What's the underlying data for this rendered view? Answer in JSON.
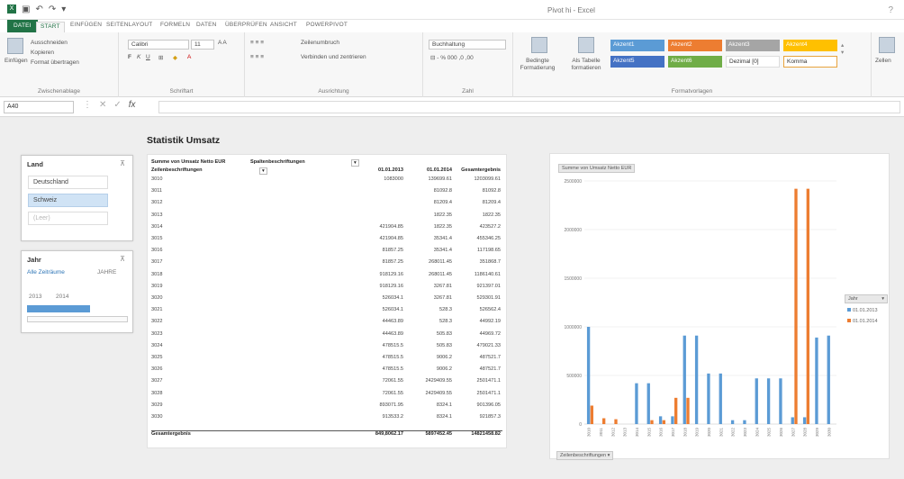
{
  "window": {
    "title": "Pivot hi - Excel"
  },
  "tabs": [
    "DATEI",
    "START",
    "EINFÜGEN",
    "SEITENLAYOUT",
    "FORMELN",
    "DATEN",
    "ÜBERPRÜFEN",
    "ANSICHT",
    "POWERPIVOT"
  ],
  "ribbon": {
    "clipboard": {
      "paste": "Einfügen",
      "cut": "Ausschneiden",
      "copy": "Kopieren",
      "format_painter": "Format übertragen",
      "label": "Zwischenablage"
    },
    "font": {
      "name": "Calibri",
      "size": "11",
      "label": "Schriftart"
    },
    "alignment": {
      "wrap": "Zeilenumbruch",
      "merge": "Verbinden und zentrieren",
      "label": "Ausrichtung"
    },
    "number": {
      "format": "Buchhaltung",
      "label": "Zahl"
    },
    "styles": {
      "conditional": "Bedingte Formatierung",
      "table": "Als Tabelle formatieren",
      "label": "Formatvorlagen",
      "cells": [
        {
          "text": "Akzent1",
          "color": "#5b9bd5"
        },
        {
          "text": "Akzent2",
          "color": "#ed7d31"
        },
        {
          "text": "Akzent3",
          "color": "#a5a5a5"
        },
        {
          "text": "Akzent4",
          "color": "#ffc000"
        },
        {
          "text": "Akzent5",
          "color": "#4472c4"
        },
        {
          "text": "Akzent6",
          "color": "#70ad47"
        },
        {
          "text": "Dezimal [0]",
          "color": "#ffffff"
        },
        {
          "text": "Komma",
          "color": "#ffffff"
        }
      ]
    },
    "cells_group": {
      "insert": "Zellen"
    }
  },
  "formula_bar": {
    "name_box": "A40",
    "fx": "fx"
  },
  "page_title": "Statistik Umsatz",
  "slicer_land": {
    "header": "Land",
    "items": [
      {
        "label": "Deutschland",
        "state": "normal"
      },
      {
        "label": "Schweiz",
        "state": "selected"
      },
      {
        "label": "(Leer)",
        "state": "dim"
      }
    ]
  },
  "slicer_jahr": {
    "header": "Jahr",
    "period": "Alle Zeiträume",
    "level": "JAHRE",
    "range_from": "2013",
    "range_to": "2014"
  },
  "pivot": {
    "corner_label": "Summe von Umsatz Netto EUR",
    "col_field": "Spaltenbeschriftungen",
    "row_field": "Zeilenbeschriftungen",
    "col_headers": [
      "01.01.2013",
      "01.01.2014",
      "Gesamtergebnis"
    ],
    "rows": [
      [
        "3010",
        "1083000",
        "139699.61",
        "1203099.61"
      ],
      [
        "3011",
        "",
        "81092.8",
        "81092.8"
      ],
      [
        "3012",
        "",
        "81209.4",
        "81209.4"
      ],
      [
        "3013",
        "",
        "1822.35",
        "1822.35"
      ],
      [
        "3014",
        "421904.85",
        "1822.35",
        "423527.2"
      ],
      [
        "3015",
        "421904.85",
        "35341.4",
        "455346.25"
      ],
      [
        "3016",
        "81857.25",
        "35341.4",
        "117198.65"
      ],
      [
        "3017",
        "81857.25",
        "268011.45",
        "351868.7"
      ],
      [
        "3018",
        "918129.16",
        "268011.45",
        "1186140.61"
      ],
      [
        "3019",
        "918129.16",
        "3267.81",
        "921397.01"
      ],
      [
        "3020",
        "526034.1",
        "3267.81",
        "529301.91"
      ],
      [
        "3021",
        "526034.1",
        "528.3",
        "526562.4"
      ],
      [
        "3022",
        "44463.89",
        "528.3",
        "44992.19"
      ],
      [
        "3023",
        "44463.89",
        "505.83",
        "44969.72"
      ],
      [
        "3024",
        "478515.5",
        "505.83",
        "479021.33"
      ],
      [
        "3025",
        "478515.5",
        "9006.2",
        "487521.7"
      ],
      [
        "3026",
        "478515.5",
        "9006.2",
        "487521.7"
      ],
      [
        "3027",
        "72061.55",
        "2429409.55",
        "2501471.1"
      ],
      [
        "3028",
        "72061.55",
        "2429409.55",
        "2501471.1"
      ],
      [
        "3029",
        "893071.95",
        "8324.1",
        "901396.05"
      ],
      [
        "3030",
        "913533.2",
        "8324.1",
        "921857.3"
      ]
    ],
    "total": [
      "Gesamtergebnis",
      "849,8062.17",
      "5897452.45",
      "14821458.82"
    ]
  },
  "chart_data": {
    "type": "bar",
    "title_button": "Summe von Umsatz Netto EUR",
    "legend_button": "Jahr",
    "axis_button": "Zeilenbeschriftungen",
    "categories": [
      "3010",
      "3011",
      "3012",
      "3013",
      "3014",
      "3015",
      "3016",
      "3017",
      "3018",
      "3019",
      "3020",
      "3021",
      "3022",
      "3023",
      "3024",
      "3025",
      "3026",
      "3027",
      "3028",
      "3029",
      "3030"
    ],
    "series": [
      {
        "name": "01.01.2013",
        "color": "#5b9bd5",
        "values": [
          1000000,
          0,
          0,
          0,
          420000,
          420000,
          80000,
          80000,
          910000,
          910000,
          520000,
          520000,
          40000,
          40000,
          470000,
          470000,
          470000,
          70000,
          70000,
          890000,
          910000
        ]
      },
      {
        "name": "01.01.2014",
        "color": "#ed7d31",
        "values": [
          190000,
          60000,
          50000,
          0,
          0,
          40000,
          40000,
          270000,
          270000,
          0,
          0,
          0,
          0,
          0,
          0,
          0,
          0,
          2420000,
          2420000,
          0,
          0
        ]
      }
    ],
    "y_ticks": [
      "0",
      "500000",
      "1000000",
      "1500000",
      "2000000",
      "2500000"
    ],
    "ylim": [
      0,
      2500000
    ],
    "legend_position": "right",
    "grid": true
  }
}
